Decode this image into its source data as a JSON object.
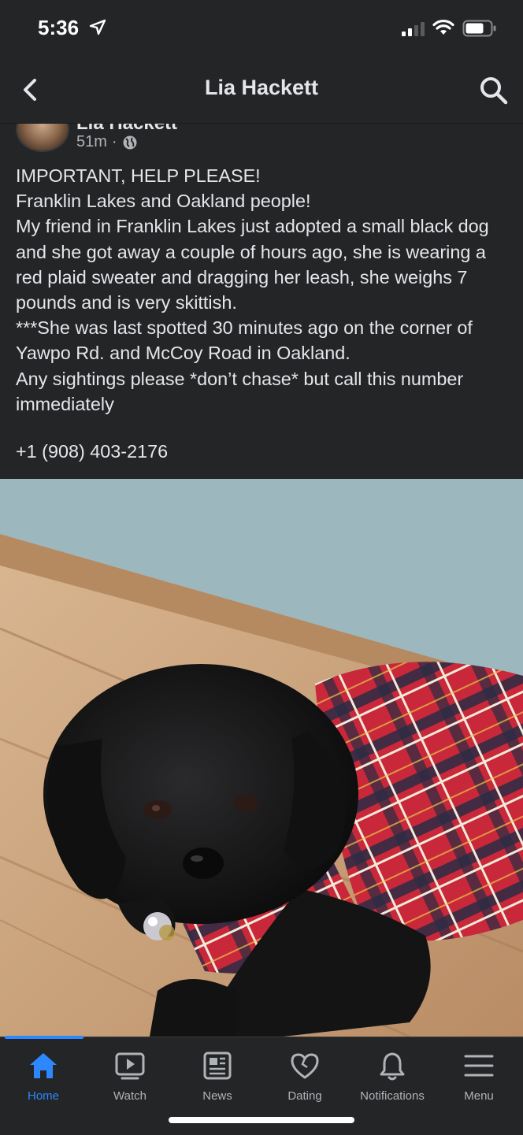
{
  "status_bar": {
    "time": "5:36"
  },
  "header": {
    "title": "Lia Hackett"
  },
  "post": {
    "author": "Lia Hackett",
    "time": "51m",
    "separator": "·",
    "text": "IMPORTANT, HELP PLEASE!\nFranklin Lakes and Oakland people!\nMy friend in Franklin Lakes just adopted a small black dog and she got away a couple of hours ago, she is wearing a red plaid sweater and dragging her leash, she weighs 7 pounds and is very skittish.\n***She was last spotted 30 minutes ago on the corner of Yawpo Rd. and McCoy Road in Oakland.\nAny sightings please *don’t chase*  but call this number immediately",
    "phone": "+1 (908) 403-2176"
  },
  "tabs": [
    {
      "label": "Home",
      "icon": "home-icon",
      "active": true
    },
    {
      "label": "Watch",
      "icon": "watch-icon",
      "active": false
    },
    {
      "label": "News",
      "icon": "news-icon",
      "active": false
    },
    {
      "label": "Dating",
      "icon": "dating-icon",
      "active": false
    },
    {
      "label": "Notifications",
      "icon": "bell-icon",
      "active": false
    },
    {
      "label": "Menu",
      "icon": "menu-icon",
      "active": false
    }
  ],
  "colors": {
    "accent": "#2d88ff",
    "background": "#242526",
    "text": "#e4e6eb",
    "muted": "#b0b3b8"
  }
}
